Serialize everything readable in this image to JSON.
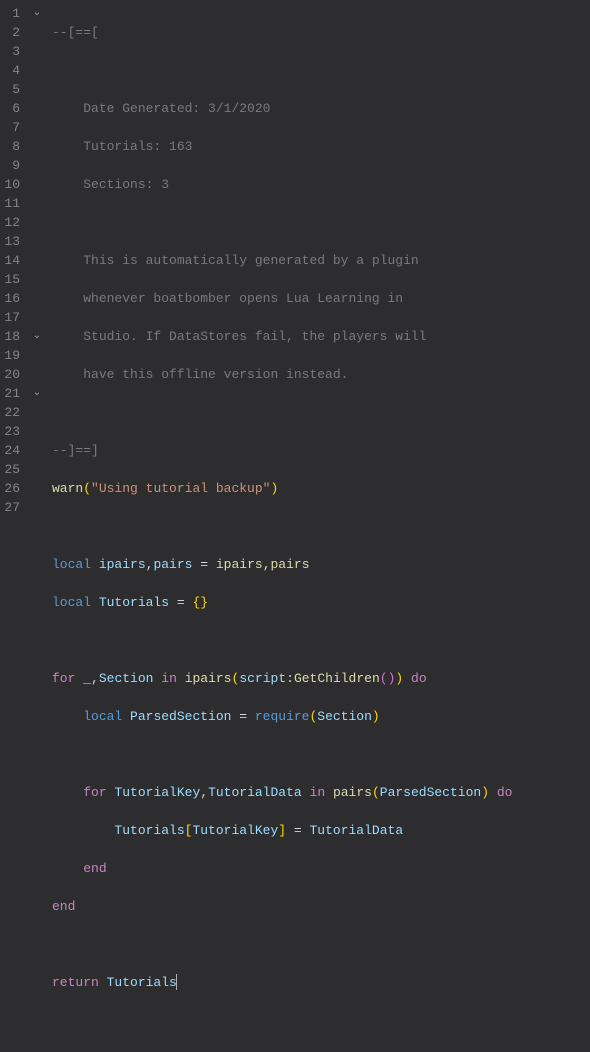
{
  "lines": {
    "1": "1",
    "2": "2",
    "3": "3",
    "4": "4",
    "5": "5",
    "6": "6",
    "7": "7",
    "8": "8",
    "9": "9",
    "10": "10",
    "11": "11",
    "12": "12",
    "13": "13",
    "14": "14",
    "15": "15",
    "16": "16",
    "17": "17",
    "18": "18",
    "19": "19",
    "20": "20",
    "21": "21",
    "22": "22",
    "23": "23",
    "24": "24",
    "25": "25",
    "26": "26",
    "27": "27"
  },
  "fold": {
    "down": "⌄"
  },
  "t": {
    "c1": "--[==[",
    "c3a": "Date Generated: 3/1/2020",
    "c4a": "Tutorials: 163",
    "c5a": "Sections: 3",
    "c7a": "This is automatically generated by a plugin",
    "c8a": "whenever boatbomber opens Lua Learning in",
    "c9a": "Studio. If DataStores fail, the players will",
    "c10a": "have this offline version instead.",
    "c12": "--]==]",
    "warn": "warn",
    "str": "\"Using tutorial backup\"",
    "local": "local",
    "ipairs": "ipairs",
    "pairs": "pairs",
    "tutorials": "Tutorials",
    "eq": " = ",
    "comma": ",",
    "braces": "{}",
    "for": "for",
    "in": "in",
    "do": "do",
    "end": "end",
    "return": "return",
    "underscore": "_",
    "section": "Section",
    "script": "script",
    "colon": ":",
    "getchildren": "GetChildren",
    "parsedsection": "ParsedSection",
    "require": "require",
    "tutorialkey": "TutorialKey",
    "tutorialdata": "TutorialData",
    "lb": "[",
    "rb": "]",
    "lp": "(",
    "rp": ")",
    "lp2": "(",
    "rp2": ")"
  }
}
